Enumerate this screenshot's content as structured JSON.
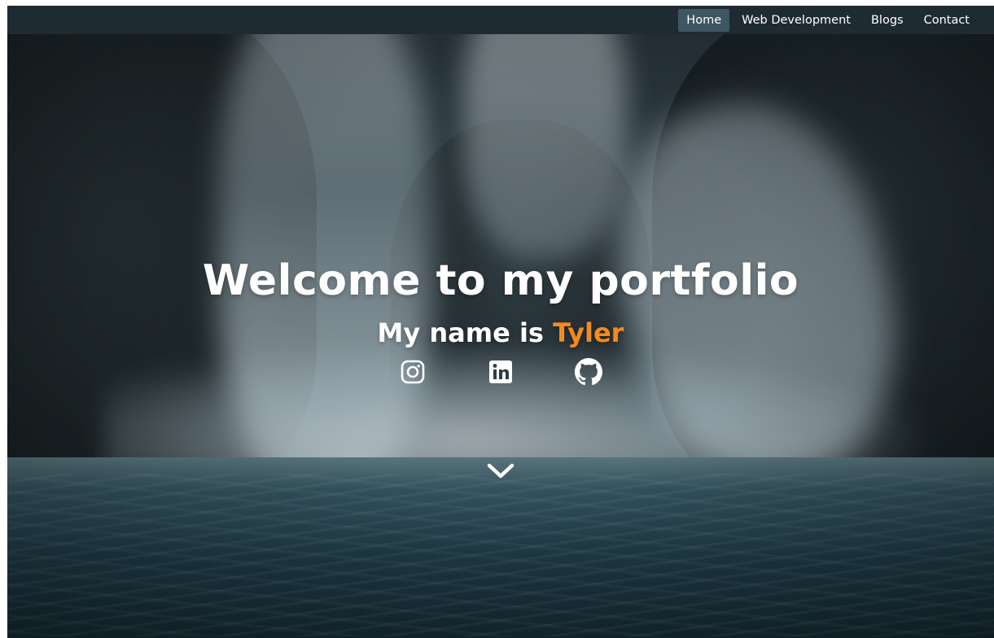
{
  "navbar": {
    "items": [
      {
        "label": "Home",
        "active": true
      },
      {
        "label": "Web Development",
        "active": false
      },
      {
        "label": "Blogs",
        "active": false
      },
      {
        "label": "Contact",
        "active": false
      }
    ],
    "active_bg": "#3e5563",
    "bar_bg": "#1f2b33"
  },
  "hero": {
    "title": "Welcome to my portfolio",
    "subtitle_prefix": "My name is",
    "name": "Tyler",
    "name_color": "#f58a1f",
    "socials": [
      {
        "icon": "instagram-icon"
      },
      {
        "icon": "linkedin-icon"
      },
      {
        "icon": "github-icon"
      }
    ],
    "scroll_icon": "chevron-down-icon"
  }
}
